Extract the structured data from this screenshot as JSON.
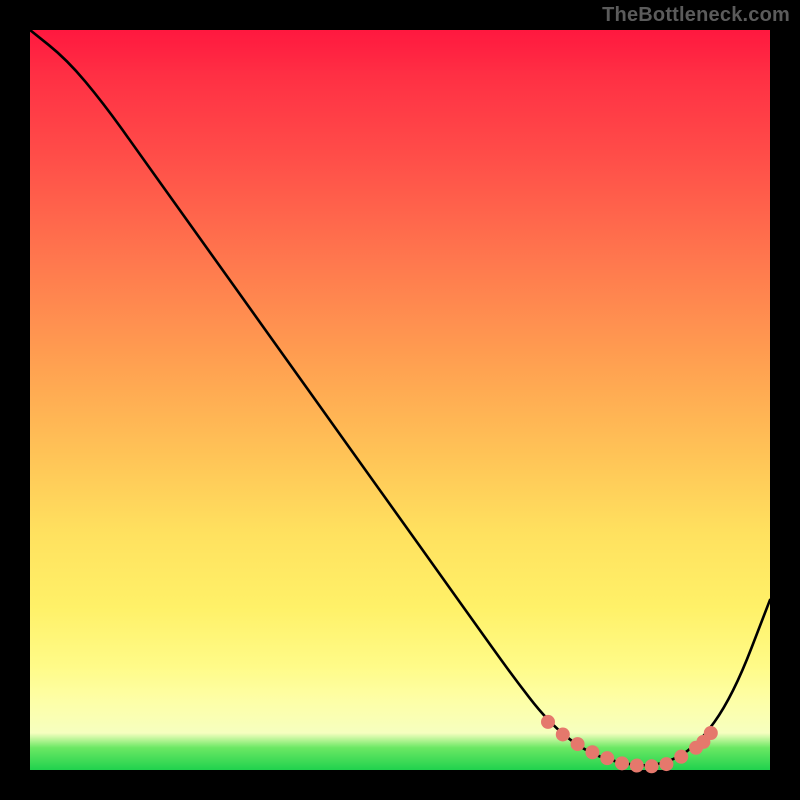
{
  "watermark": "TheBottleneck.com",
  "chart_data": {
    "type": "line",
    "title": "",
    "xlabel": "",
    "ylabel": "",
    "xlim": [
      0,
      100
    ],
    "ylim": [
      0,
      100
    ],
    "grid": false,
    "series": [
      {
        "name": "curve",
        "color": "#000000",
        "x": [
          0,
          5,
          10,
          15,
          20,
          25,
          30,
          35,
          40,
          45,
          50,
          55,
          60,
          65,
          70,
          75,
          80,
          85,
          90,
          95,
          100
        ],
        "values": [
          100,
          96,
          90,
          83,
          76,
          69,
          62,
          55,
          48,
          41,
          34,
          27,
          20,
          13,
          6.5,
          2.5,
          0.8,
          0.5,
          3.0,
          10,
          23
        ]
      },
      {
        "name": "markers",
        "color": "#e5786c",
        "x": [
          70,
          72,
          74,
          76,
          78,
          80,
          82,
          84,
          86,
          88,
          90,
          91,
          92
        ],
        "values": [
          6.5,
          4.8,
          3.5,
          2.4,
          1.6,
          0.9,
          0.6,
          0.5,
          0.8,
          1.8,
          3.0,
          3.8,
          5.0
        ]
      }
    ]
  }
}
